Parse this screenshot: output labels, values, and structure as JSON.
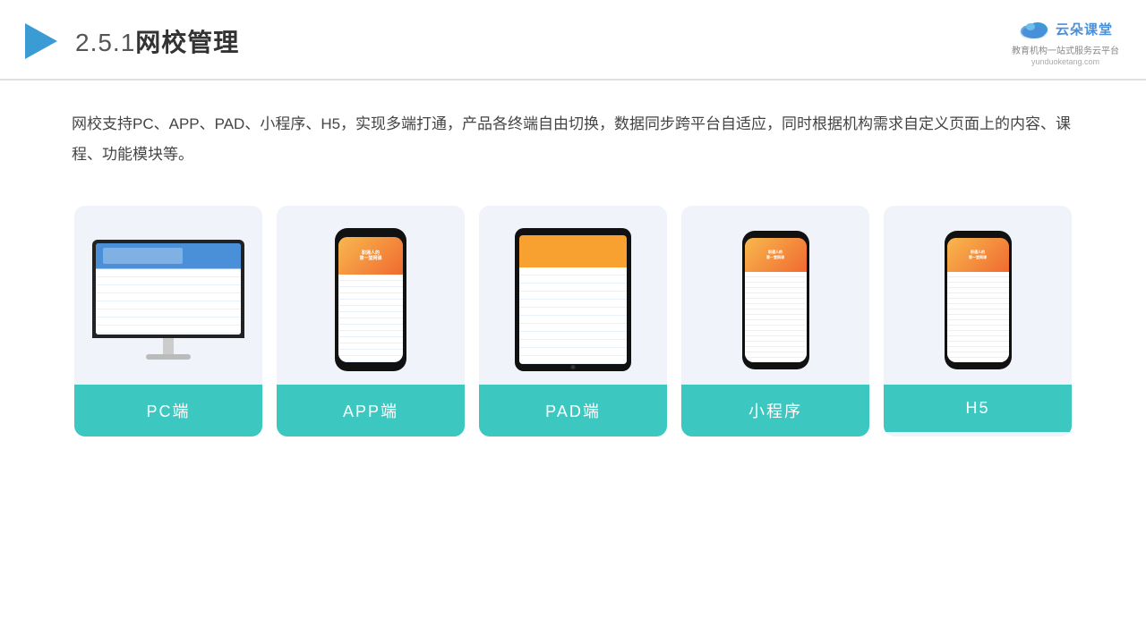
{
  "header": {
    "title_num": "2.5.1",
    "title_text": "网校管理",
    "logo_name": "云朵课堂",
    "logo_url": "yunduoketang.com",
    "logo_tagline": "教育机构一站\n式服务云平台"
  },
  "description": {
    "text": "网校支持PC、APP、PAD、小程序、H5，实现多端打通，产品各终端自由切换，数据同步跨平台自适应，同时根据机构需求自定义页面上的内容、课程、功能模块等。"
  },
  "cards": [
    {
      "id": "pc",
      "label": "PC端",
      "device": "monitor"
    },
    {
      "id": "app",
      "label": "APP端",
      "device": "phone"
    },
    {
      "id": "pad",
      "label": "PAD端",
      "device": "tablet"
    },
    {
      "id": "miniprogram",
      "label": "小程序",
      "device": "mini-phone"
    },
    {
      "id": "h5",
      "label": "H5",
      "device": "mini-phone2"
    }
  ]
}
